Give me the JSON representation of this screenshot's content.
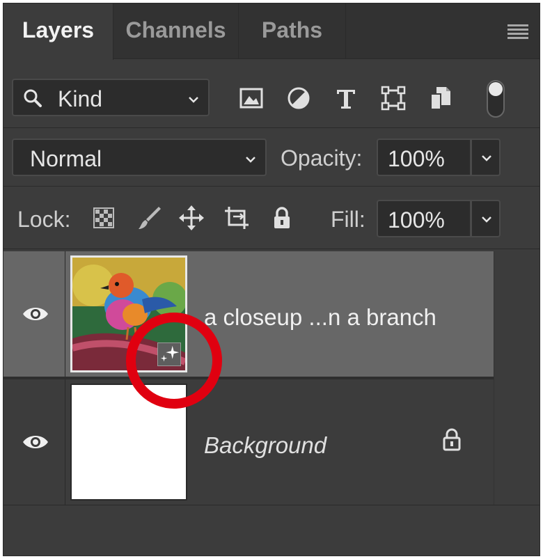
{
  "tabs": [
    {
      "label": "Layers",
      "active": true
    },
    {
      "label": "Channels",
      "active": false
    },
    {
      "label": "Paths",
      "active": false
    }
  ],
  "filter": {
    "kind_label": "Kind",
    "icons": [
      "image-filter-icon",
      "adjustment-filter-icon",
      "type-filter-icon",
      "shape-filter-icon",
      "smart-object-filter-icon"
    ],
    "toggle_on": true
  },
  "blend": {
    "mode": "Normal",
    "opacity_label": "Opacity:",
    "opacity_value": "100%"
  },
  "lock": {
    "label": "Lock:",
    "icons": [
      "lock-transparent-pixels-icon",
      "lock-image-pixels-icon",
      "lock-position-icon",
      "lock-artboard-icon",
      "lock-all-icon"
    ],
    "fill_label": "Fill:",
    "fill_value": "100%"
  },
  "layers": [
    {
      "name": "a closeup ...n a branch",
      "visible": true,
      "selected": true,
      "type": "generative",
      "locked": false
    },
    {
      "name": "Background",
      "visible": true,
      "selected": false,
      "type": "background",
      "locked": true
    }
  ],
  "colors": {
    "panel_bg": "#3c3c3c",
    "selected_row": "#676767",
    "highlight_ring": "#e00010"
  }
}
